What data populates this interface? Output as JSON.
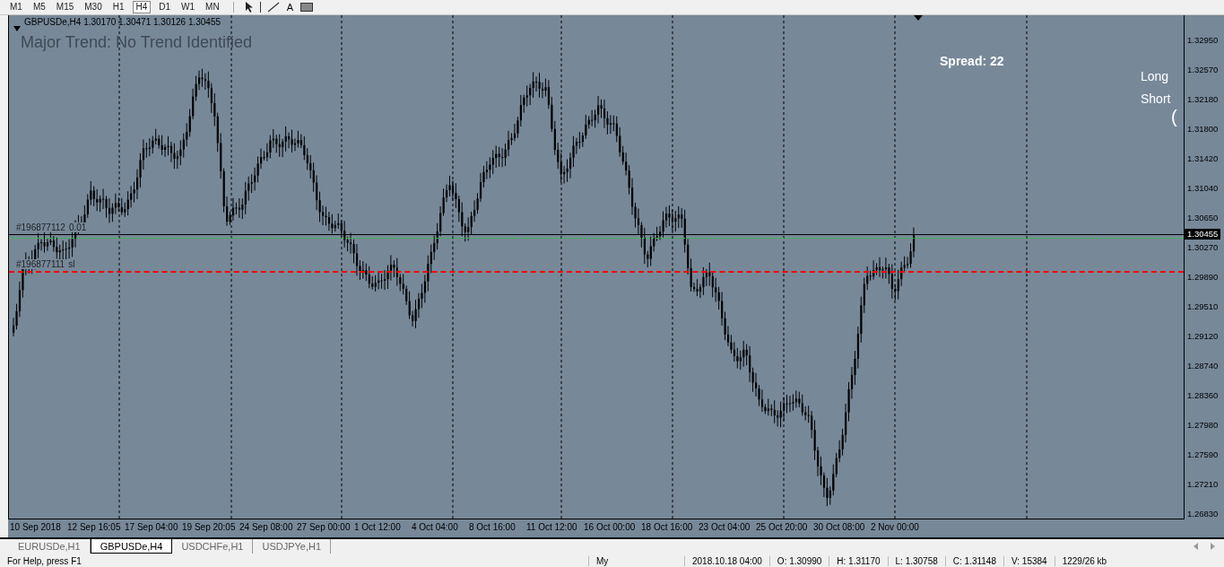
{
  "toolbar": {
    "timeframes": [
      {
        "label": "M1",
        "selected": false
      },
      {
        "label": "M5",
        "selected": false
      },
      {
        "label": "M15",
        "selected": false
      },
      {
        "label": "M30",
        "selected": false
      },
      {
        "label": "H1",
        "selected": false
      },
      {
        "label": "H4",
        "selected": true
      },
      {
        "label": "D1",
        "selected": false
      },
      {
        "label": "W1",
        "selected": false
      },
      {
        "label": "MN",
        "selected": false
      }
    ],
    "text_tool": "A"
  },
  "chart": {
    "title": "GBPUSDe,H4  1.30170 1.30471 1.30126 1.30455",
    "trend_text": "Major Trend: No Trend Identified",
    "spread": "Spread: 22",
    "long_label": "Long",
    "short_label": "Short",
    "bracket": "(",
    "lines": [
      {
        "kind": "current",
        "labels": [
          "#196877112",
          "0.01"
        ]
      },
      {
        "kind": "ask"
      },
      {
        "kind": "stop",
        "labels": [
          "#196877111",
          "sl"
        ]
      }
    ],
    "current_price": "1.30455",
    "price_ticks": [
      "1.32950",
      "1.32570",
      "1.32180",
      "1.31800",
      "1.31420",
      "1.31040",
      "1.30650",
      "1.30270",
      "1.29890",
      "1.29510",
      "1.29120",
      "1.28740",
      "1.28360",
      "1.27980",
      "1.27590",
      "1.27210",
      "1.26830"
    ],
    "time_ticks": [
      "10 Sep 2018",
      "12 Sep 16:05",
      "17 Sep 04:00",
      "19 Sep 20:05",
      "24 Sep 08:00",
      "27 Sep 00:00",
      "1 Oct 12:00",
      "4 Oct 04:00",
      "8 Oct 16:00",
      "11 Oct 12:00",
      "16 Oct 00:00",
      "18 Oct 16:00",
      "23 Oct 04:00",
      "25 Oct 20:00",
      "30 Oct 08:00",
      "2 Nov 00:00"
    ]
  },
  "tabs": [
    {
      "label": "EURUSDe,H1",
      "selected": false
    },
    {
      "label": "GBPUSDe,H4",
      "selected": true
    },
    {
      "label": "USDCHFe,H1",
      "selected": false
    },
    {
      "label": "USDJPYe,H1",
      "selected": false
    }
  ],
  "status_bar": [
    "For Help, press F1",
    "My",
    "2018.10.18 04:00",
    "O: 1.30990",
    "H: 1.31170",
    "L: 1.30758",
    "C: 1.31148",
    "V: 15384",
    "1229/26 kb"
  ]
}
